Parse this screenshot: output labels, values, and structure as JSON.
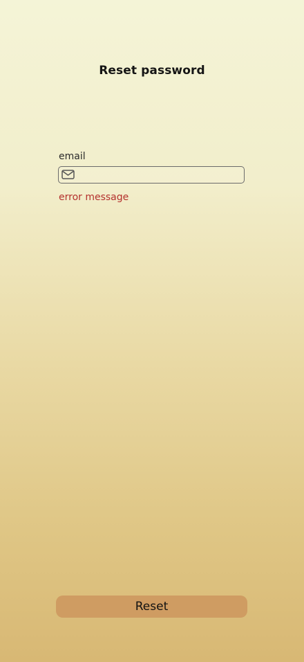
{
  "screen": {
    "title": "Reset password"
  },
  "form": {
    "email_label": "email",
    "email_value": "",
    "email_placeholder": "",
    "error_message": "error message",
    "icon": "mail-icon"
  },
  "actions": {
    "reset_label": "Reset"
  },
  "colors": {
    "error": "#b4302d",
    "button": "#cf9c62",
    "input_border": "#6a6a6a",
    "background_top": "#f4f4d7",
    "background_bottom": "#d8b874"
  }
}
